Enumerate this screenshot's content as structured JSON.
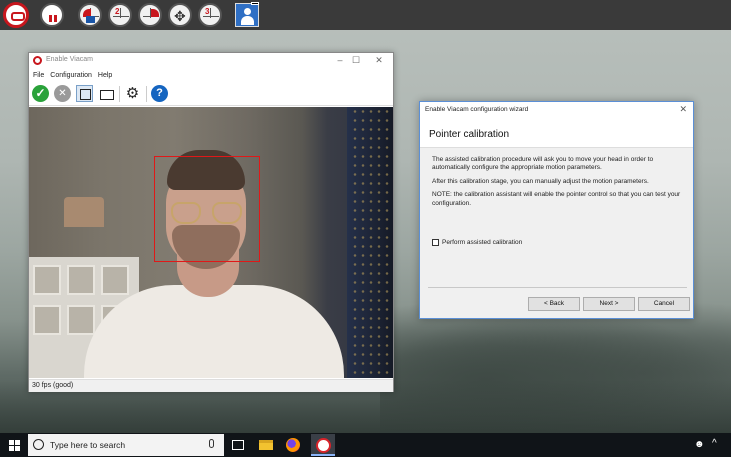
{
  "top_toolbar": {
    "icons": [
      "viacam-logo-icon",
      "pause-icon",
      "lock-icon",
      "left-click-icon",
      "right-click-icon",
      "drag-icon",
      "double-click-icon",
      "user-icon"
    ],
    "click_numbers": [
      "2",
      "3"
    ]
  },
  "viacam": {
    "title": "Enable Viacam",
    "menu": [
      "File",
      "Configuration",
      "Help"
    ],
    "status": "30 fps (good)"
  },
  "wizard": {
    "title": "Enable Viacam configuration wizard",
    "heading": "Pointer calibration",
    "paragraphs": [
      "The assisted calibration procedure will ask you to move your head in order to automatically configure the appropriate motion parameters.",
      "After this calibration stage, you can manually adjust the motion parameters.",
      "NOTE: the calibration assistant will enable the pointer control so that you can test your configuration."
    ],
    "checkbox_label": "Perform assisted calibration",
    "buttons": {
      "back": "< Back",
      "next": "Next >",
      "cancel": "Cancel"
    }
  },
  "taskbar": {
    "search_placeholder": "Type here to search"
  },
  "colors": {
    "accent_red": "#c8161d",
    "dialog_border": "#5b8fd6",
    "taskbar": "#101418"
  }
}
